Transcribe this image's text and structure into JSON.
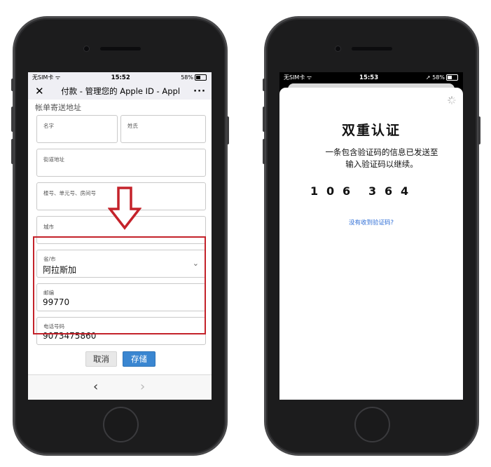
{
  "left": {
    "status": {
      "carrier": "无SIM卡",
      "time": "15:52",
      "battery": "58%",
      "battery_level": 0.58
    },
    "nav": {
      "close": "✕",
      "title": "付款 - 管理您的 Apple ID - Appl",
      "more": "···"
    },
    "form": {
      "section_title": "帐单寄送地址",
      "first_name_label": "名字",
      "last_name_label": "姓氏",
      "street_label": "街道地址",
      "unit_label": "楼号、单元号、房间号",
      "city_label": "城市",
      "state_label": "省/市",
      "state_value": "阿拉斯加",
      "zip_label": "邮编",
      "zip_value": "99770",
      "phone_label": "电话号码",
      "phone_value": "9073475860"
    },
    "buttons": {
      "cancel": "取消",
      "save": "存储"
    },
    "toolbar": {
      "back": "‹",
      "forward": "›"
    }
  },
  "right": {
    "status": {
      "carrier": "无SIM卡",
      "time": "15:53",
      "battery": "58%",
      "battery_level": 0.58
    },
    "tfa": {
      "title": "双重认证",
      "line1": "一条包含验证码的信息已发送至",
      "line2": "输入验证码以继续。",
      "digits": [
        "1",
        "0",
        "6",
        "3",
        "6",
        "4"
      ],
      "resend": "没有收到验证码?"
    }
  },
  "colors": {
    "highlight": "#c4222a",
    "save_button": "#3a86d1",
    "link": "#2f6ed6"
  }
}
